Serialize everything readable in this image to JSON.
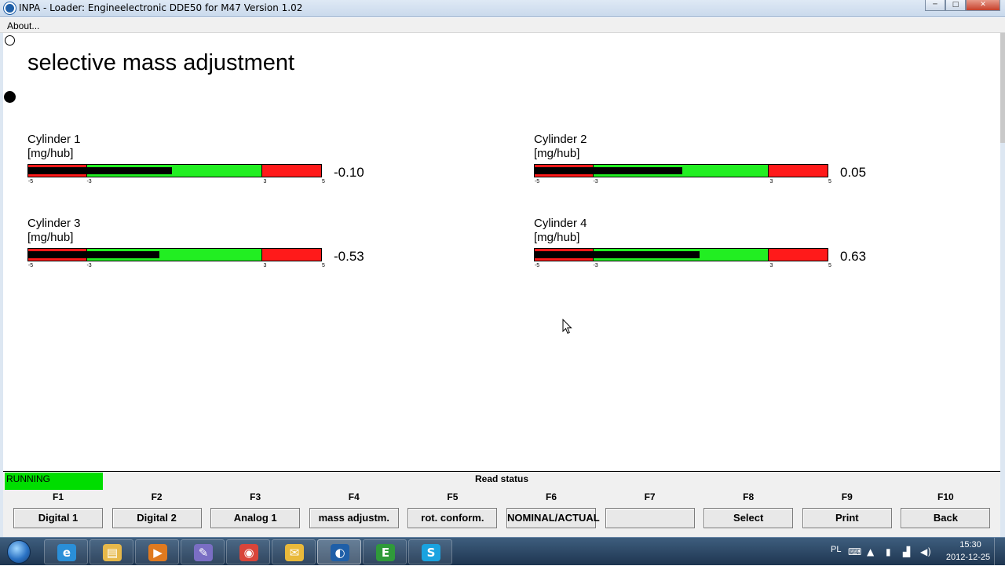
{
  "window": {
    "title": "INPA - Loader:  Engineelectronic DDE50 for M47 Version 1.02",
    "buttons": {
      "minimize": "─",
      "maximize": "□",
      "close": "✕"
    }
  },
  "menu": {
    "about": "About..."
  },
  "page": {
    "title": "selective mass adjustment"
  },
  "gauges": [
    {
      "name": "Cylinder 1",
      "unit": "[mg/hub]",
      "value_text": "-0.10",
      "value": -0.1
    },
    {
      "name": "Cylinder 2",
      "unit": "[mg/hub]",
      "value_text": "0.05",
      "value": 0.05
    },
    {
      "name": "Cylinder 3",
      "unit": "[mg/hub]",
      "value_text": "-0.53",
      "value": -0.53
    },
    {
      "name": "Cylinder 4",
      "unit": "[mg/hub]",
      "value_text": "0.63",
      "value": 0.63
    }
  ],
  "gauge_scale": {
    "min": -5,
    "max": 5,
    "green_low": -3,
    "green_high": 3,
    "tick_labels": [
      "-5",
      "-3",
      "3",
      "5"
    ]
  },
  "status": {
    "running": "RUNNING",
    "read_status": "Read status"
  },
  "function_keys": [
    {
      "key": "F1",
      "label": "Digital 1"
    },
    {
      "key": "F2",
      "label": "Digital 2"
    },
    {
      "key": "F3",
      "label": "Analog 1"
    },
    {
      "key": "F4",
      "label": "mass adjustm."
    },
    {
      "key": "F5",
      "label": "rot. conform."
    },
    {
      "key": "F6",
      "label": "NOMINAL/ACTUAL"
    },
    {
      "key": "F7",
      "label": ""
    },
    {
      "key": "F8",
      "label": "Select"
    },
    {
      "key": "F9",
      "label": "Print"
    },
    {
      "key": "F10",
      "label": "Back"
    }
  ],
  "taskbar": {
    "apps": [
      {
        "name": "internet-explorer",
        "glyph": "e",
        "color": "#2a8fd8"
      },
      {
        "name": "file-explorer",
        "glyph": "▤",
        "color": "#e6b84a"
      },
      {
        "name": "media-player",
        "glyph": "▶",
        "color": "#e07a1f"
      },
      {
        "name": "tools-app",
        "glyph": "✎",
        "color": "#7a6ec4"
      },
      {
        "name": "chrome",
        "glyph": "◉",
        "color": "#d9453a"
      },
      {
        "name": "mail-app",
        "glyph": "✉",
        "color": "#e9b93a"
      },
      {
        "name": "bmw-inpa",
        "glyph": "◐",
        "color": "#1f5fa8"
      },
      {
        "name": "ediabas-app",
        "glyph": "E",
        "color": "#2f9a3a"
      },
      {
        "name": "skype",
        "glyph": "S",
        "color": "#1aa3e0"
      }
    ],
    "tray": {
      "lang": "PL",
      "time": "15:30",
      "date": "2012-12-25"
    }
  },
  "colors": {
    "running": "#00dd00",
    "gauge_red": "#ff1a1a",
    "gauge_green": "#22ee22",
    "needle": "#000000"
  }
}
